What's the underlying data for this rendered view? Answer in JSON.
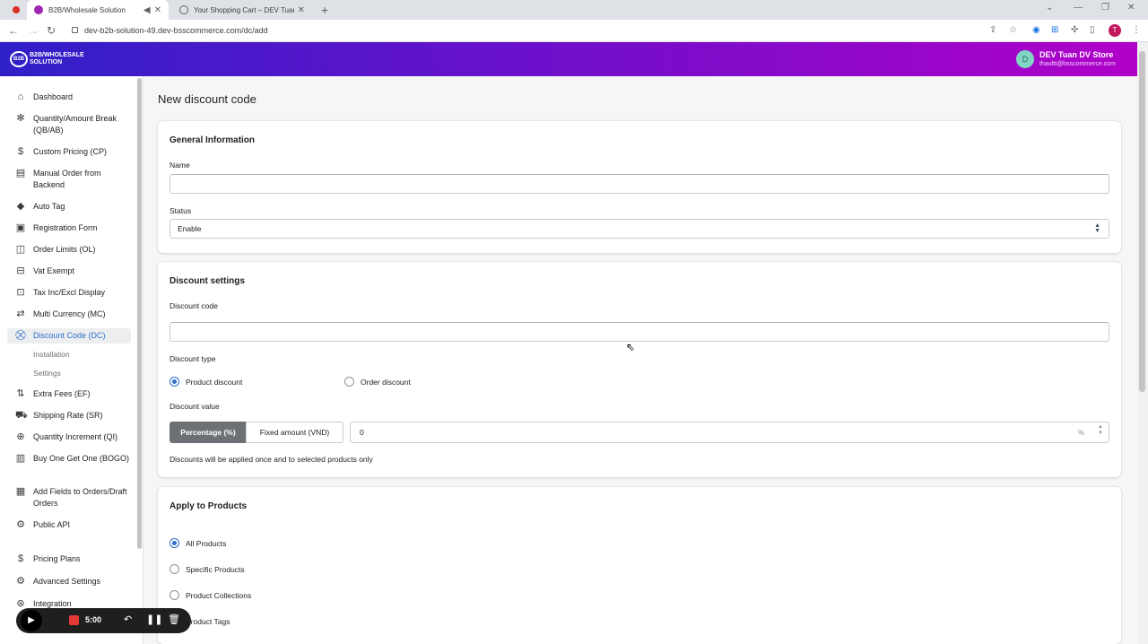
{
  "browser": {
    "tabs": [
      {
        "title": "B2B/Wholesale Solution",
        "active": true
      },
      {
        "title": "Your Shopping Cart – DEV Tuan I",
        "active": false
      }
    ],
    "url": "dev-b2b-solution-49.dev-bsscommerce.com/dc/add",
    "profile_initial": "T"
  },
  "app": {
    "logo_mark": "B2B",
    "logo_text": "B2B/WHOLESALE SOLUTION",
    "store_initial": "D",
    "store_name": "DEV Tuan DV Store",
    "store_email": "thaoltt@bsscommerce.com"
  },
  "sidebar": {
    "items": [
      {
        "label": "Dashboard",
        "icon": "home-icon"
      },
      {
        "label": "Quantity/Amount Break (QB/AB)",
        "icon": "discount-icon"
      },
      {
        "label": "Custom Pricing (CP)",
        "icon": "dollar-icon"
      },
      {
        "label": "Manual Order from Backend",
        "icon": "order-icon"
      },
      {
        "label": "Auto Tag",
        "icon": "tag-icon"
      },
      {
        "label": "Registration Form",
        "icon": "form-icon"
      },
      {
        "label": "Order Limits (OL)",
        "icon": "limit-icon"
      },
      {
        "label": "Vat Exempt",
        "icon": "vat-icon"
      },
      {
        "label": "Tax Inc/Excl Display",
        "icon": "tax-icon"
      },
      {
        "label": "Multi Currency (MC)",
        "icon": "currency-icon"
      },
      {
        "label": "Discount Code (DC)",
        "icon": "discount-code-icon",
        "active": true
      },
      {
        "label": "Extra Fees (EF)",
        "icon": "fees-icon"
      },
      {
        "label": "Shipping Rate (SR)",
        "icon": "truck-icon"
      },
      {
        "label": "Quantity Increment (QI)",
        "icon": "increment-icon"
      },
      {
        "label": "Buy One Get One (BOGO)",
        "icon": "gift-icon"
      },
      {
        "label": "Add Fields to Orders/Draft Orders",
        "icon": "fields-icon"
      },
      {
        "label": "Public API",
        "icon": "api-icon"
      },
      {
        "label": "Pricing Plans",
        "icon": "pricing-icon"
      },
      {
        "label": "Advanced Settings",
        "icon": "settings-icon"
      },
      {
        "label": "Integration",
        "icon": "integration-icon"
      }
    ],
    "subitems": [
      "Installation",
      "Settings"
    ]
  },
  "page": {
    "title": "New discount code"
  },
  "general": {
    "title": "General Information",
    "name_label": "Name",
    "name_value": "",
    "status_label": "Status",
    "status_value": "Enable"
  },
  "discount": {
    "title": "Discount settings",
    "code_label": "Discount code",
    "code_value": "",
    "type_label": "Discount type",
    "type_options": [
      "Product discount",
      "Order discount"
    ],
    "type_selected": "Product discount",
    "value_label": "Discount value",
    "value_modes": [
      "Percentage (%)",
      "Fixed amount (VND)"
    ],
    "value_mode_selected": "Percentage (%)",
    "value": "0",
    "value_suffix": "%",
    "help": "Discounts will be applied once and to selected products only"
  },
  "apply": {
    "title": "Apply to Products",
    "options": [
      "All Products",
      "Specific Products",
      "Product Collections",
      "Product Tags"
    ],
    "selected": "All Products"
  },
  "recorder": {
    "time": "5:00"
  },
  "colors": {
    "header_start": "#2f20c8",
    "header_end": "#b000c8",
    "accent": "#2c6ecb"
  }
}
